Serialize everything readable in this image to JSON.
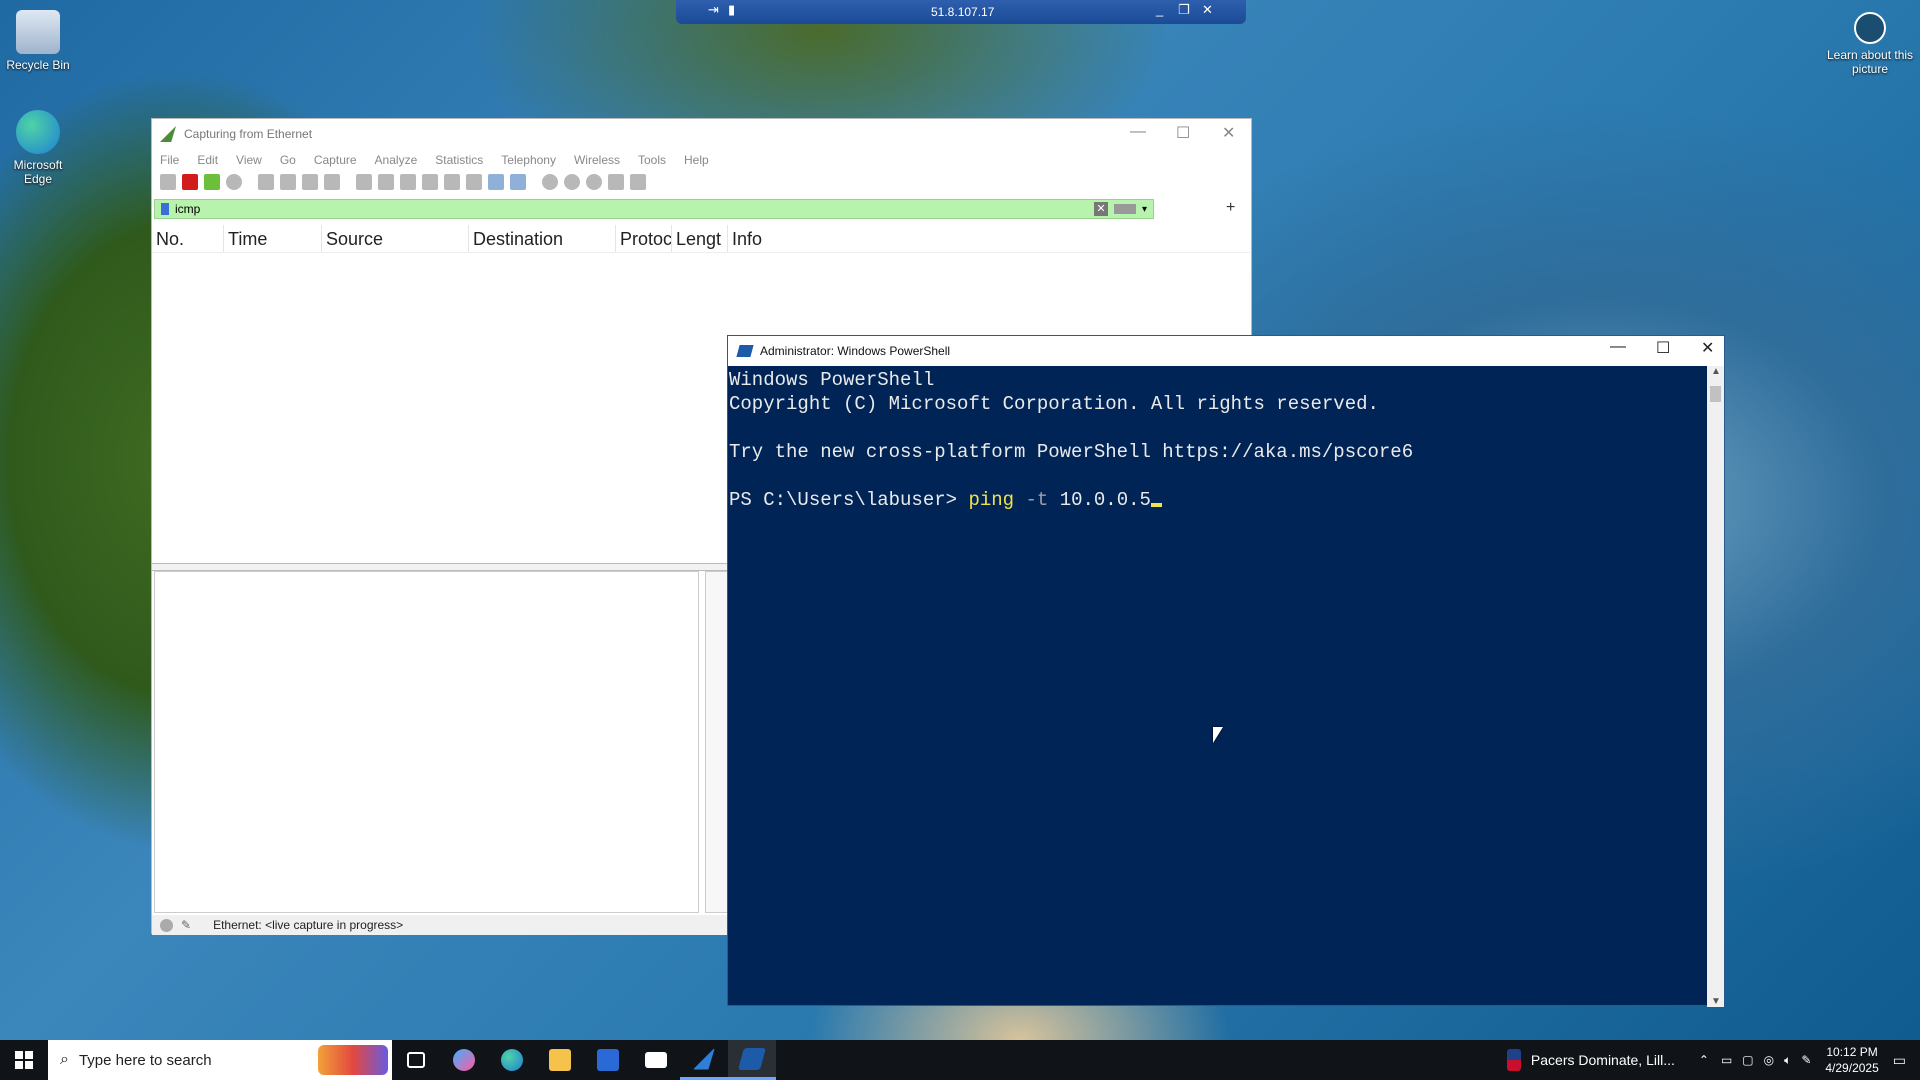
{
  "desktop": {
    "icons": [
      {
        "label": "Recycle Bin"
      },
      {
        "label": "Microsoft Edge"
      }
    ],
    "learn_label": "Learn about this picture"
  },
  "rdp_bar": {
    "ip": "51.8.107.17"
  },
  "wireshark": {
    "title": "Capturing from Ethernet",
    "menu": [
      "File",
      "Edit",
      "View",
      "Go",
      "Capture",
      "Analyze",
      "Statistics",
      "Telephony",
      "Wireless",
      "Tools",
      "Help"
    ],
    "filter_value": "icmp",
    "columns": [
      "No.",
      "Time",
      "Source",
      "Destination",
      "Protoc",
      "Lengt",
      "Info"
    ],
    "status_text": "Ethernet: <live capture in progress>"
  },
  "powershell": {
    "title": "Administrator: Windows PowerShell",
    "line1": "Windows PowerShell",
    "line2": "Copyright (C) Microsoft Corporation. All rights reserved.",
    "line3": "Try the new cross-platform PowerShell https://aka.ms/pscore6",
    "prompt": "PS C:\\Users\\labuser> ",
    "cmd": "ping",
    "flag": "-t",
    "arg": "10.0.0.5"
  },
  "taskbar": {
    "search_placeholder": "Type here to search",
    "news": "Pacers Dominate, Lill...",
    "time": "10:12 PM",
    "date": "4/29/2025"
  }
}
